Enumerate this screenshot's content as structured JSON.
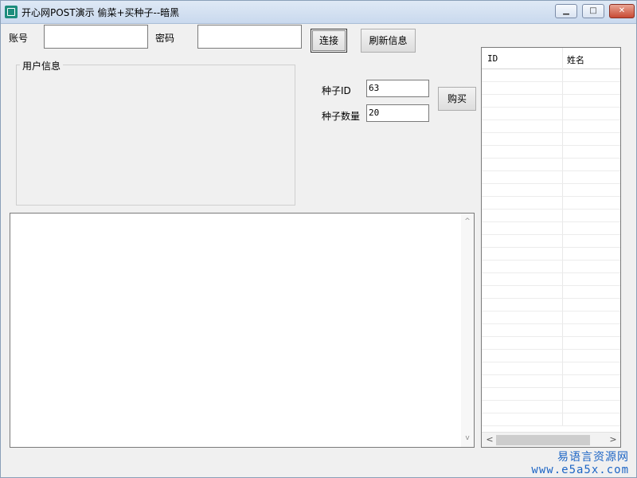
{
  "window": {
    "title": "开心网POST演示 偷菜+买种子--暗黑",
    "minimize_symbol": "▁",
    "maximize_symbol": "□",
    "close_symbol": "✕"
  },
  "login": {
    "account_label": "账号",
    "password_label": "密码",
    "connect_button": "连接",
    "refresh_button": "刷新信息"
  },
  "user_info": {
    "group_title": "用户信息"
  },
  "seed": {
    "id_label": "种子ID",
    "id_value": "63",
    "quantity_label": "种子数量",
    "quantity_value": "20",
    "buy_button": "购买"
  },
  "list": {
    "columns": [
      "ID",
      "姓名"
    ]
  },
  "scrollbars": {
    "up_arrow": "^",
    "down_arrow": "v",
    "left_arrow": "<",
    "right_arrow": ">"
  },
  "watermark": {
    "line1": "易语言资源网",
    "line2": "www.e5a5x.com"
  }
}
